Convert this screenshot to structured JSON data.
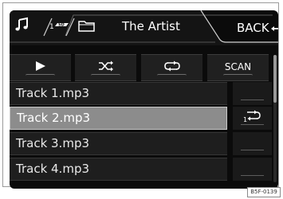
{
  "header": {
    "folder_title": "The Artist",
    "back_label": "BACK",
    "tabs": [
      {
        "icon": "music-note-icon"
      },
      {
        "icon": "sd-card-icon",
        "label": "SD"
      },
      {
        "icon": "folder-icon"
      }
    ]
  },
  "controls": {
    "play_icon": "play-icon",
    "shuffle_icon": "shuffle-icon",
    "repeat_icon": "repeat-icon",
    "scan_label": "SCAN"
  },
  "tracks": [
    {
      "name": "Track 1.mp3",
      "selected": false
    },
    {
      "name": "Track 2.mp3",
      "selected": true
    },
    {
      "name": "Track 3.mp3",
      "selected": false
    },
    {
      "name": "Track 4.mp3",
      "selected": false
    }
  ],
  "side_buttons": {
    "repeat_one_icon": "repeat-one-icon",
    "repeat_one_digit": "1"
  },
  "reference_code": "B5F-0139",
  "colors": {
    "screen_bg": "#0b0b0b",
    "selected_row": "#8c8c8c",
    "text": "#ffffff"
  }
}
